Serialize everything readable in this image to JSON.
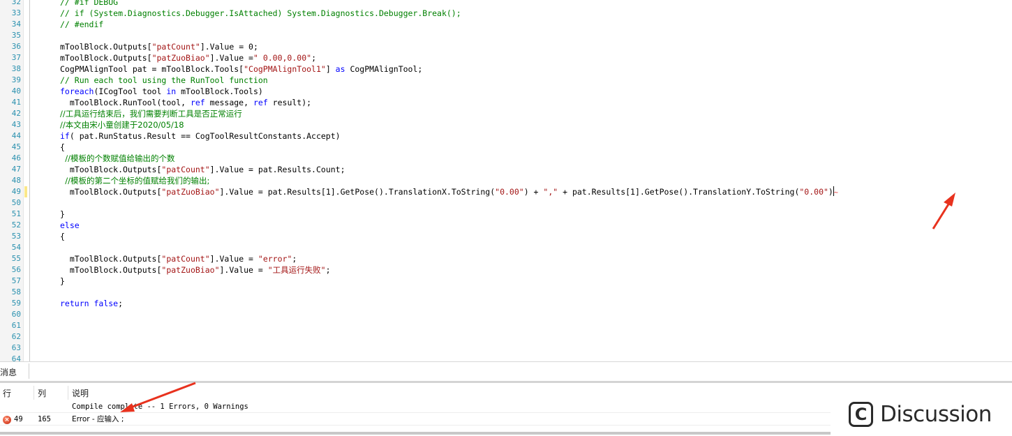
{
  "editor": {
    "lines": [
      {
        "n": "32",
        "segs": [
          {
            "t": "// #if DEBUG",
            "c": "cm"
          }
        ]
      },
      {
        "n": "33",
        "segs": [
          {
            "t": "// if (System.Diagnostics.Debugger.IsAttached) System.Diagnostics.Debugger.Break();",
            "c": "cm"
          }
        ]
      },
      {
        "n": "34",
        "segs": [
          {
            "t": "// #endif",
            "c": "cm"
          }
        ]
      },
      {
        "n": "35",
        "segs": []
      },
      {
        "n": "36",
        "segs": [
          {
            "t": "mToolBlock.Outputs[",
            "c": ""
          },
          {
            "t": "\"patCount\"",
            "c": "str"
          },
          {
            "t": "].Value = 0;",
            "c": ""
          }
        ]
      },
      {
        "n": "37",
        "segs": [
          {
            "t": "mToolBlock.Outputs[",
            "c": ""
          },
          {
            "t": "\"patZuoBiao\"",
            "c": "str"
          },
          {
            "t": "].Value =",
            "c": ""
          },
          {
            "t": "\" 0.00,0.00\"",
            "c": "str"
          },
          {
            "t": ";",
            "c": ""
          }
        ]
      },
      {
        "n": "38",
        "segs": [
          {
            "t": "CogPMAlignTool pat = mToolBlock.Tools[",
            "c": ""
          },
          {
            "t": "\"CogPMAlignTool1\"",
            "c": "str"
          },
          {
            "t": "] ",
            "c": ""
          },
          {
            "t": "as",
            "c": "kw"
          },
          {
            "t": " CogPMAlignTool;",
            "c": ""
          }
        ]
      },
      {
        "n": "39",
        "segs": [
          {
            "t": "// Run each tool using the RunTool function",
            "c": "cm"
          }
        ]
      },
      {
        "n": "40",
        "segs": [
          {
            "t": "foreach",
            "c": "kw"
          },
          {
            "t": "(ICogTool tool ",
            "c": ""
          },
          {
            "t": "in",
            "c": "kw"
          },
          {
            "t": " mToolBlock.Tools)",
            "c": ""
          }
        ]
      },
      {
        "n": "41",
        "segs": [
          {
            "t": "  mToolBlock.RunTool(tool, ",
            "c": ""
          },
          {
            "t": "ref",
            "c": "kw"
          },
          {
            "t": " message, ",
            "c": ""
          },
          {
            "t": "ref",
            "c": "kw"
          },
          {
            "t": " result);",
            "c": ""
          }
        ]
      },
      {
        "n": "42",
        "segs": [
          {
            "t": "//工具运行结束后，我们需要判断工具是否正常运行",
            "c": "cm cjk"
          }
        ]
      },
      {
        "n": "43",
        "segs": [
          {
            "t": "//本文由宋小童创建于2020/05/18",
            "c": "cm cjk"
          }
        ]
      },
      {
        "n": "44",
        "segs": [
          {
            "t": "if",
            "c": "kw"
          },
          {
            "t": "( pat.RunStatus.Result == CogToolResultConstants.Accept)",
            "c": ""
          }
        ]
      },
      {
        "n": "45",
        "segs": [
          {
            "t": "{",
            "c": ""
          }
        ]
      },
      {
        "n": "46",
        "segs": [
          {
            "t": "  //模板的个数赋值给输出的个数",
            "c": "cm cjk"
          }
        ]
      },
      {
        "n": "47",
        "segs": [
          {
            "t": "  mToolBlock.Outputs[",
            "c": ""
          },
          {
            "t": "\"patCount\"",
            "c": "str"
          },
          {
            "t": "].Value = pat.Results.Count;",
            "c": ""
          }
        ]
      },
      {
        "n": "48",
        "segs": [
          {
            "t": "  //模板的第二个坐标的值赋给我们的输出;",
            "c": "cm cjk"
          }
        ]
      },
      {
        "n": "49",
        "segs": [
          {
            "t": "  mToolBlock.Outputs[",
            "c": ""
          },
          {
            "t": "\"patZuoBiao\"",
            "c": "str"
          },
          {
            "t": "].Value = pat.Results[1].GetPose().TranslationX.ToString(",
            "c": ""
          },
          {
            "t": "\"0.00\"",
            "c": "str"
          },
          {
            "t": ") + ",
            "c": ""
          },
          {
            "t": "\",\"",
            "c": "str"
          },
          {
            "t": " + pat.Results[1].GetPose().TranslationY.ToString(",
            "c": ""
          },
          {
            "t": "\"0.00\"",
            "c": "str"
          },
          {
            "t": ")",
            "c": ""
          }
        ]
      },
      {
        "n": "50",
        "segs": []
      },
      {
        "n": "51",
        "segs": [
          {
            "t": "}",
            "c": ""
          }
        ]
      },
      {
        "n": "52",
        "segs": [
          {
            "t": "else",
            "c": "kw"
          }
        ]
      },
      {
        "n": "53",
        "segs": [
          {
            "t": "{",
            "c": ""
          }
        ]
      },
      {
        "n": "54",
        "segs": []
      },
      {
        "n": "55",
        "segs": [
          {
            "t": "  mToolBlock.Outputs[",
            "c": ""
          },
          {
            "t": "\"patCount\"",
            "c": "str"
          },
          {
            "t": "].Value = ",
            "c": ""
          },
          {
            "t": "\"error\"",
            "c": "str"
          },
          {
            "t": ";",
            "c": ""
          }
        ]
      },
      {
        "n": "56",
        "segs": [
          {
            "t": "  mToolBlock.Outputs[",
            "c": ""
          },
          {
            "t": "\"patZuoBiao\"",
            "c": "str"
          },
          {
            "t": "].Value = ",
            "c": ""
          },
          {
            "t": "\"工具运行失败\"",
            "c": "str"
          },
          {
            "t": ";",
            "c": ""
          }
        ]
      },
      {
        "n": "57",
        "segs": [
          {
            "t": "}",
            "c": ""
          }
        ]
      },
      {
        "n": "58",
        "segs": []
      },
      {
        "n": "59",
        "segs": [
          {
            "t": "return",
            "c": "kw"
          },
          {
            "t": " ",
            "c": ""
          },
          {
            "t": "false",
            "c": "kw"
          },
          {
            "t": ";",
            "c": ""
          }
        ]
      },
      {
        "n": "60",
        "segs": []
      },
      {
        "n": "61",
        "segs": []
      },
      {
        "n": "62",
        "segs": []
      },
      {
        "n": "63",
        "segs": []
      },
      {
        "n": "64",
        "segs": []
      }
    ],
    "caret_line": "49",
    "modified_line": "49"
  },
  "messages": {
    "tab_label": "消息",
    "columns": {
      "line": "行",
      "col": "列",
      "desc": "说明"
    },
    "rows": [
      {
        "icon": "",
        "line": "",
        "col": "",
        "desc": "Compile complete -- 1 Errors, 0 Warnings"
      },
      {
        "icon": "error-icon",
        "line": "49",
        "col": "165",
        "desc": "Error - 应输入 ;"
      }
    ]
  },
  "watermark": {
    "text": "Discussion",
    "icon_letter": "C"
  },
  "colors": {
    "keyword": "#0000ff",
    "string": "#a31515",
    "comment": "#008000",
    "line_number": "#2b91af",
    "arrow": "#e8321e"
  }
}
